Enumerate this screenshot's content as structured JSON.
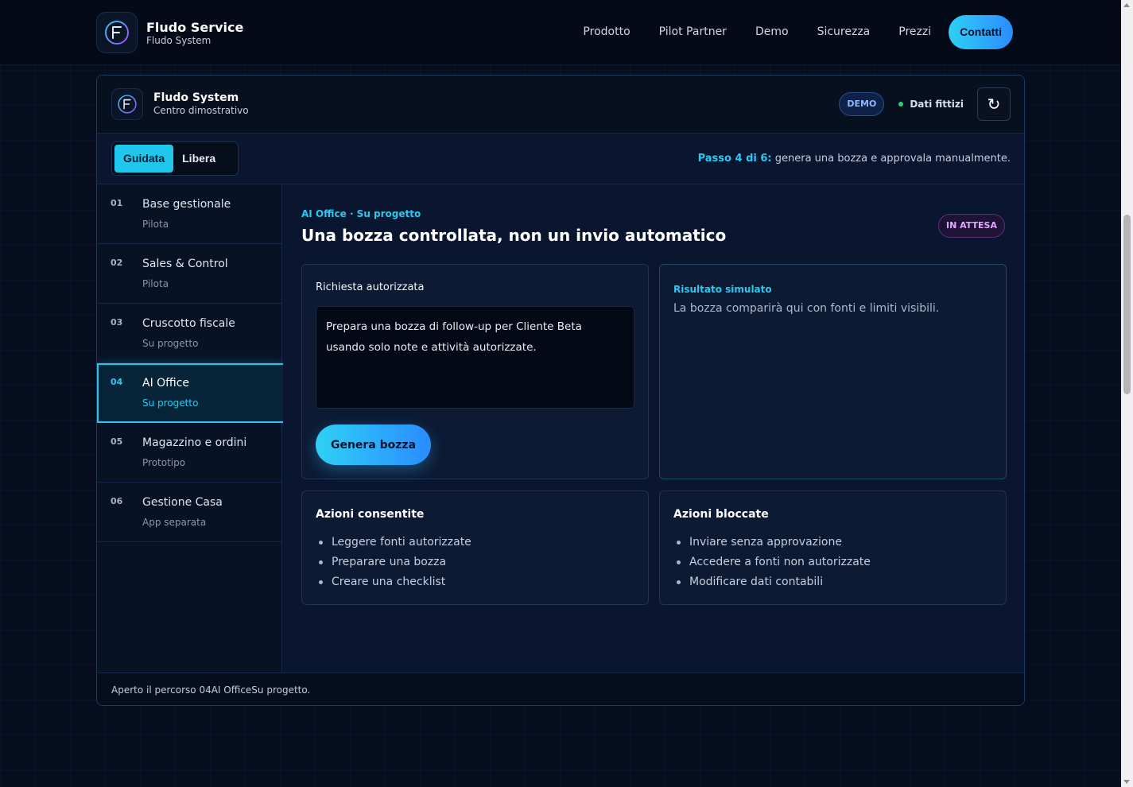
{
  "header": {
    "brand_title": "Fludo Service",
    "brand_subtitle": "Fludo System",
    "logo_icon": "fludo-logo-icon",
    "nav": [
      "Prodotto",
      "Pilot Partner",
      "Demo",
      "Sicurezza",
      "Prezzi"
    ],
    "cta_label": "Contatti"
  },
  "panel": {
    "title": "Fludo System",
    "subtitle": "Centro dimostrativo",
    "demo_badge": "DEMO",
    "fake_data_label": "Dati fittizi",
    "refresh_icon": "refresh-icon"
  },
  "modes": {
    "guided": "Guidata",
    "free": "Libera",
    "active": "Guidata"
  },
  "step_info": {
    "highlight": "Passo 4 di 6:",
    "text": " genera una bozza e approvala manualmente."
  },
  "steps": [
    {
      "num": "01",
      "title": "Base gestionale",
      "status": "Pilota"
    },
    {
      "num": "02",
      "title": "Sales & Control",
      "status": "Pilota"
    },
    {
      "num": "03",
      "title": "Cruscotto fiscale",
      "status": "Su progetto"
    },
    {
      "num": "04",
      "title": "AI Office",
      "status": "Su progetto",
      "active": true
    },
    {
      "num": "05",
      "title": "Magazzino e ordini",
      "status": "Prototipo"
    },
    {
      "num": "06",
      "title": "Gestione Casa",
      "status": "App separata"
    }
  ],
  "main": {
    "eyebrow": "AI Office · Su progetto",
    "title": "Una bozza controllata, non un invio automatico",
    "status_badge": "IN ATTESA",
    "request_label": "Richiesta autorizzata",
    "request_value": "Prepara una bozza di follow-up per Cliente Beta usando solo note e attività autorizzate.",
    "generate_label": "Genera bozza",
    "result_label": "Risultato simulato",
    "result_text": "La bozza comparirà qui con fonti e limiti visibili.",
    "allowed_title": "Azioni consentite",
    "allowed": [
      "Leggere fonti autorizzate",
      "Preparare una bozza",
      "Creare una checklist"
    ],
    "blocked_title": "Azioni bloccate",
    "blocked": [
      "Inviare senza approvazione",
      "Accedere a fonti non autorizzate",
      "Modificare dati contabili"
    ]
  },
  "footer": {
    "status": "Aperto il percorso 04AI OfficeSu progetto."
  },
  "colors": {
    "accent": "#2cc8f0",
    "background": "#050d1f",
    "panel": "#091429"
  }
}
